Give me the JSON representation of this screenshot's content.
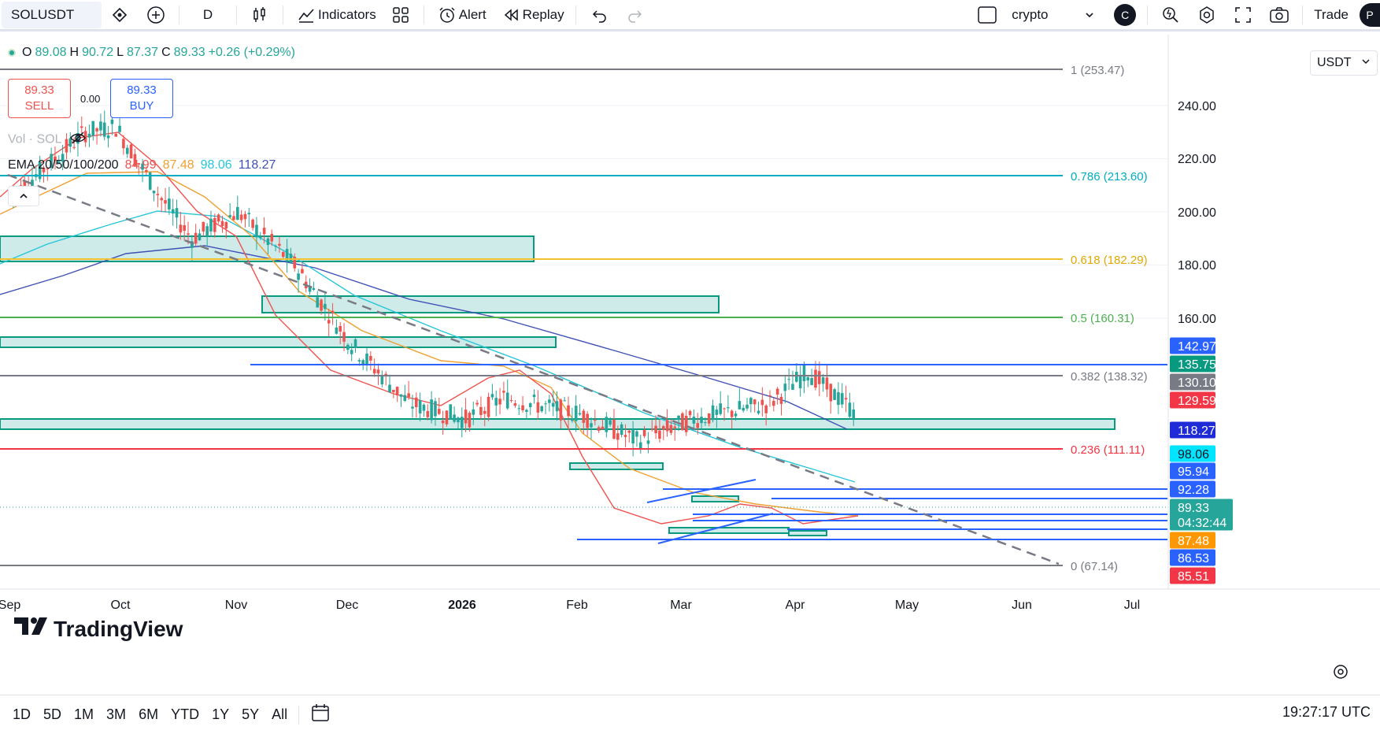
{
  "toolbar": {
    "symbol": "SOLUSDT",
    "interval": "D",
    "indicators_label": "Indicators",
    "alert_label": "Alert",
    "replay_label": "Replay",
    "layout_name": "crypto",
    "avatar_letter": "C",
    "trade_label": "Trade",
    "profile_letter": "P"
  },
  "legend": {
    "open_label": "O",
    "open": "89.08",
    "high_label": "H",
    "high": "90.72",
    "low_label": "L",
    "low": "87.37",
    "close_label": "C",
    "close": "89.33",
    "change": "+0.26 (+0.29%)"
  },
  "trade": {
    "sell_price": "89.33",
    "sell_label": "SELL",
    "buy_price": "89.33",
    "buy_label": "BUY",
    "spread": "0.00"
  },
  "vol_label": "Vol · SOL",
  "ema": {
    "label": "EMA 20/50/100/200",
    "v20": "84.99",
    "v50": "87.48",
    "v100": "98.06",
    "v200": "118.27",
    "c20": "#ef5350",
    "c50": "#f0a030",
    "c100": "#26c6da",
    "c200": "#3f51b5"
  },
  "currency": "USDT",
  "price_axis": {
    "ticks": [
      "240.00",
      "220.00",
      "200.00",
      "180.00",
      "160.00"
    ]
  },
  "price_labels": [
    {
      "text": "142.97",
      "bg": "#2962ff",
      "fg": "#ffffff"
    },
    {
      "text": "135.75",
      "bg": "#089981",
      "fg": "#ffffff"
    },
    {
      "text": "130.10",
      "bg": "#787b86",
      "fg": "#ffffff"
    },
    {
      "text": "129.59",
      "bg": "#f23645",
      "fg": "#ffffff"
    },
    {
      "text": "118.27",
      "bg": "#1e2bd6",
      "fg": "#ffffff"
    },
    {
      "text": "98.06",
      "bg": "#00e5ff",
      "fg": "#131722"
    },
    {
      "text": "95.94",
      "bg": "#2962ff",
      "fg": "#ffffff"
    },
    {
      "text": "92.28",
      "bg": "#2962ff",
      "fg": "#ffffff"
    },
    {
      "text": "89.33",
      "bg": "#26a69a",
      "fg": "#ffffff"
    },
    {
      "text": "04:32:44",
      "bg": "#26a69a",
      "fg": "#ffffff"
    },
    {
      "text": "87.48",
      "bg": "#ff9800",
      "fg": "#ffffff"
    },
    {
      "text": "86.53",
      "bg": "#2962ff",
      "fg": "#ffffff"
    },
    {
      "text": "85.51",
      "bg": "#f23645",
      "fg": "#ffffff"
    }
  ],
  "fib_levels": [
    {
      "label": "1 (253.47)",
      "color": "#787b86"
    },
    {
      "label": "0.786 (213.60)",
      "color": "#00acc1"
    },
    {
      "label": "0.618 (182.29)",
      "color": "#f2c12e"
    },
    {
      "label": "0.5 (160.31)",
      "color": "#4caf50"
    },
    {
      "label": "0.382 (138.32)",
      "color": "#787b86"
    },
    {
      "label": "0.236 (111.11)",
      "color": "#f23645"
    },
    {
      "label": "0 (67.14)",
      "color": "#787b86"
    }
  ],
  "time_axis": [
    "Sep",
    "Oct",
    "Nov",
    "Dec",
    "2026",
    "Feb",
    "Mar",
    "Apr",
    "May",
    "Jun",
    "Jul"
  ],
  "ranges": [
    "1D",
    "5D",
    "1M",
    "3M",
    "6M",
    "YTD",
    "1Y",
    "5Y",
    "All"
  ],
  "clock": "19:27:17 UTC",
  "logo_text": "TradingView"
}
